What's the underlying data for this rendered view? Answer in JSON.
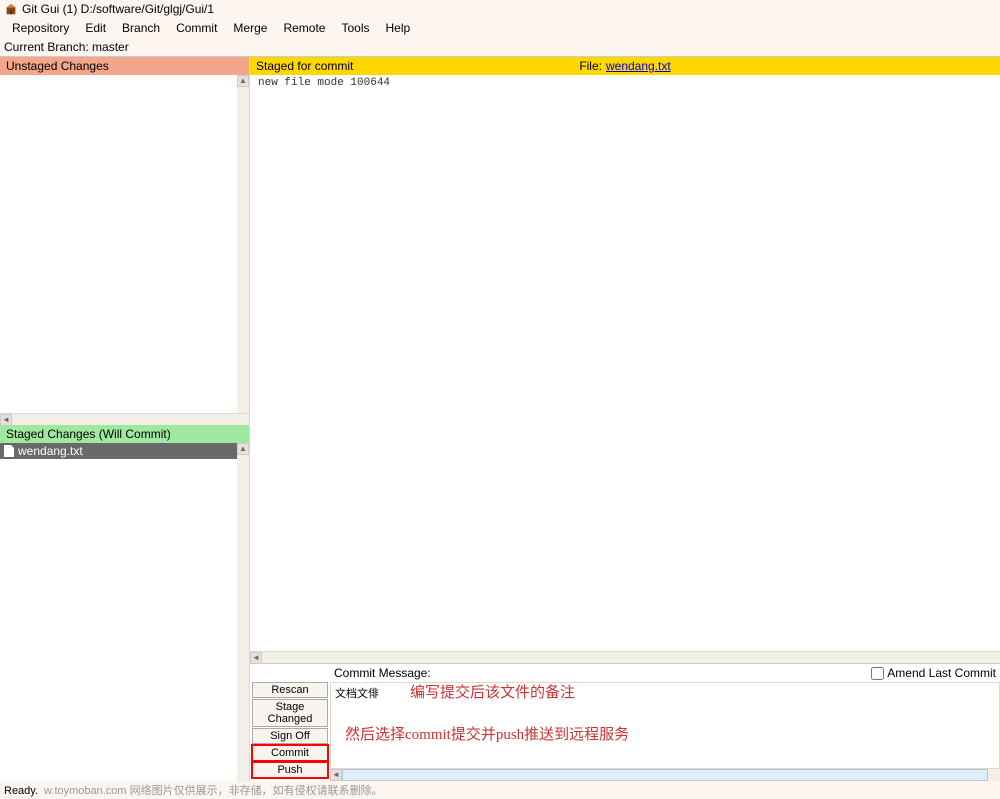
{
  "title": "Git Gui (1) D:/software/Git/glgj/Gui/1",
  "menu": [
    "Repository",
    "Edit",
    "Branch",
    "Commit",
    "Merge",
    "Remote",
    "Tools",
    "Help"
  ],
  "branch_label": "Current Branch: master",
  "panels": {
    "unstaged_header": "Unstaged Changes",
    "staged_header": "Staged Changes (Will Commit)",
    "staged_file": "wendang.txt"
  },
  "diff": {
    "staged_for_commit": "Staged for commit",
    "file_label": "File:",
    "file_name": "wendang.txt",
    "content": "new file mode 100644"
  },
  "commit": {
    "msg_label": "Commit Message:",
    "amend_label": "Amend Last Commit",
    "msg_value": "文档文俳",
    "buttons": {
      "rescan": "Rescan",
      "stage_changed": "Stage Changed",
      "sign_off": "Sign Off",
      "commit": "Commit",
      "push": "Push"
    }
  },
  "annotations": {
    "line1": "编写提交后该文件的备注",
    "line2": "然后选择commit提交并push推送到远程服务"
  },
  "status": {
    "ready": "Ready.",
    "watermark": "w.toymoban.com 网络图片仅供展示，非存储，如有侵权请联系删除。"
  }
}
